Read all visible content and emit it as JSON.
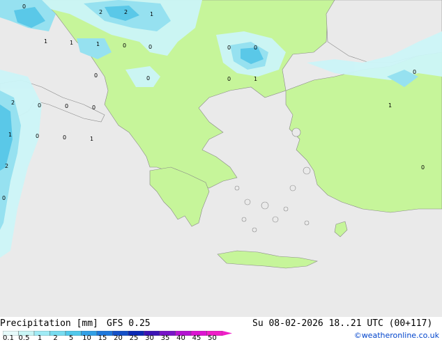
{
  "title": {
    "left": "Precipitation [mm]",
    "model": "GFS 0.25",
    "datetime": "Su 08-02-2026 18..21 UTC (00+117)"
  },
  "credit": "©weatheronline.co.uk",
  "legend": {
    "labels": [
      "0.1",
      "0.5",
      "1",
      "2",
      "5",
      "10",
      "15",
      "20",
      "25",
      "30",
      "35",
      "40",
      "45",
      "50"
    ],
    "colors": [
      "#e6fafa",
      "#c8f5f5",
      "#a0ebf5",
      "#78dcf0",
      "#50c8eb",
      "#32a0e6",
      "#1e78dc",
      "#1450c8",
      "#0a28b4",
      "#3c14b4",
      "#7814c8",
      "#b414d2",
      "#dc14d2",
      "#f01ec8"
    ]
  },
  "map_colors": {
    "sea": "#eaeaea",
    "land": "#c6f59a",
    "land_other": "#eaeaea",
    "precip_light": "#ccf5f8",
    "precip_mid": "#96e1f0",
    "precip_heavy": "#5ac8e8"
  },
  "contour_labels": [
    "0",
    "2",
    "2",
    "1",
    "1",
    "1",
    "1",
    "0",
    "0",
    "0",
    "0",
    "0",
    "0",
    "0",
    "1",
    "0",
    "2",
    "0",
    "0",
    "0",
    "1",
    "1",
    "0",
    "0",
    "1",
    "2",
    "0",
    "0"
  ]
}
